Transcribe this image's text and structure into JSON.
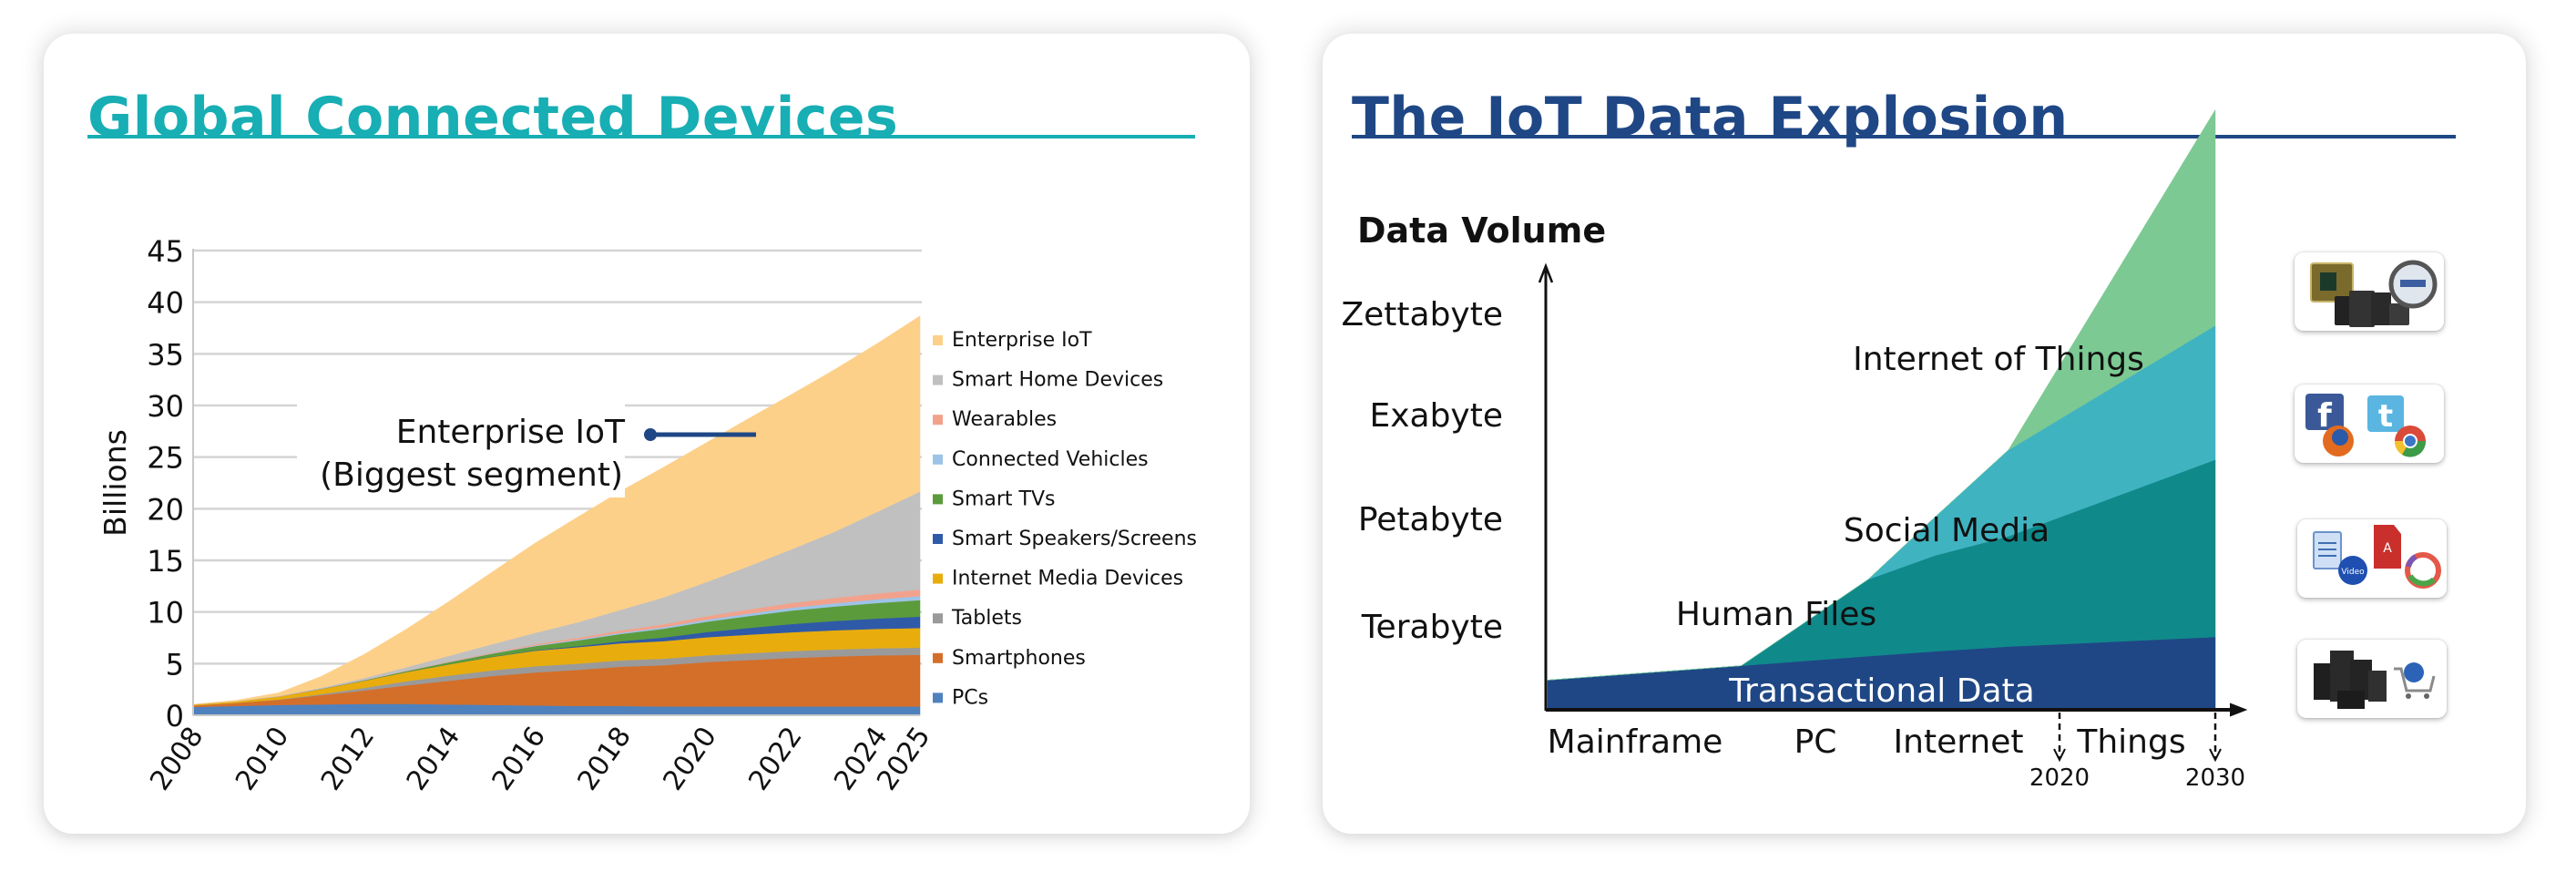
{
  "left_panel": {
    "title": "Global Connected Devices",
    "accent_color": "#17aeb4",
    "annotation": {
      "line1": "Enterprise IoT",
      "line2": "(Biggest segment)",
      "pointer_color": "#1f4785"
    }
  },
  "right_panel": {
    "title": "The IoT Data Explosion",
    "accent_color": "#1f4785",
    "icon_tiles": [
      {
        "name": "iot-devices-tile",
        "icons": [
          "chip-board-icon",
          "mobile-devices-icon",
          "smart-meter-icon"
        ]
      },
      {
        "name": "social-media-tile",
        "icons": [
          "facebook-icon",
          "twitter-icon",
          "firefox-icon",
          "chrome-icon"
        ]
      },
      {
        "name": "human-files-tile",
        "icons": [
          "document-icon",
          "video-icon",
          "pdf-icon",
          "picasa-icon"
        ]
      },
      {
        "name": "transactional-tile",
        "icons": [
          "server-rack-icon",
          "shopping-cart-icon"
        ]
      }
    ]
  },
  "chart_data": [
    {
      "type": "area",
      "stacked": true,
      "title": "Global Connected Devices",
      "xlabel": "",
      "ylabel": "Billions",
      "ylim": [
        0,
        45
      ],
      "yticks": [
        0,
        5,
        10,
        15,
        20,
        25,
        30,
        35,
        40,
        45
      ],
      "grid": true,
      "legend_position": "right",
      "x": [
        2008,
        2009,
        2010,
        2011,
        2012,
        2013,
        2014,
        2015,
        2016,
        2017,
        2018,
        2019,
        2020,
        2021,
        2022,
        2023,
        2024,
        2025
      ],
      "xtick_labels": [
        "2008",
        "2010",
        "2012",
        "2014",
        "2016",
        "2018",
        "2020",
        "2022",
        "2024",
        "2025"
      ],
      "series": [
        {
          "name": "PCs",
          "color": "#4f81bd",
          "values": [
            0.8,
            0.9,
            1.0,
            1.05,
            1.1,
            1.1,
            1.05,
            1.0,
            0.95,
            0.9,
            0.9,
            0.85,
            0.85,
            0.85,
            0.85,
            0.85,
            0.85,
            0.85
          ]
        },
        {
          "name": "Smartphones",
          "color": "#d46f2a",
          "values": [
            0.15,
            0.3,
            0.5,
            0.9,
            1.3,
            1.8,
            2.3,
            2.8,
            3.2,
            3.5,
            3.8,
            4.0,
            4.3,
            4.5,
            4.7,
            4.85,
            4.95,
            5.0
          ]
        },
        {
          "name": "Tablets",
          "color": "#9a9a9a",
          "values": [
            0.0,
            0.0,
            0.02,
            0.1,
            0.25,
            0.4,
            0.5,
            0.55,
            0.6,
            0.6,
            0.62,
            0.63,
            0.65,
            0.66,
            0.67,
            0.68,
            0.69,
            0.7
          ]
        },
        {
          "name": "Internet Media Devices",
          "color": "#e8ad0d",
          "values": [
            0.1,
            0.15,
            0.3,
            0.5,
            0.7,
            0.9,
            1.1,
            1.3,
            1.5,
            1.6,
            1.65,
            1.7,
            1.75,
            1.8,
            1.82,
            1.85,
            1.88,
            1.9
          ]
        },
        {
          "name": "Smart Speakers/Screens",
          "color": "#2f5aa8",
          "values": [
            0.0,
            0.0,
            0.0,
            0.0,
            0.0,
            0.0,
            0.0,
            0.02,
            0.05,
            0.1,
            0.2,
            0.35,
            0.5,
            0.65,
            0.8,
            0.9,
            1.0,
            1.1
          ]
        },
        {
          "name": "Smart TVs",
          "color": "#5b9b3c",
          "values": [
            0.0,
            0.0,
            0.0,
            0.02,
            0.05,
            0.1,
            0.2,
            0.3,
            0.4,
            0.55,
            0.7,
            0.85,
            1.0,
            1.15,
            1.3,
            1.4,
            1.5,
            1.6
          ]
        },
        {
          "name": "Connected Vehicles",
          "color": "#9dc3e6",
          "values": [
            0.0,
            0.0,
            0.0,
            0.0,
            0.0,
            0.0,
            0.02,
            0.04,
            0.06,
            0.09,
            0.12,
            0.15,
            0.2,
            0.24,
            0.28,
            0.32,
            0.36,
            0.4
          ]
        },
        {
          "name": "Wearables",
          "color": "#f2a28c",
          "values": [
            0.0,
            0.0,
            0.0,
            0.0,
            0.0,
            0.02,
            0.05,
            0.08,
            0.12,
            0.17,
            0.22,
            0.28,
            0.34,
            0.4,
            0.46,
            0.52,
            0.57,
            0.62
          ]
        },
        {
          "name": "Smart Home Devices",
          "color": "#c0c0c0",
          "values": [
            0.0,
            0.0,
            0.05,
            0.1,
            0.2,
            0.35,
            0.55,
            0.8,
            1.1,
            1.5,
            2.0,
            2.6,
            3.3,
            4.2,
            5.2,
            6.4,
            7.9,
            9.5
          ]
        },
        {
          "name": "Enterprise IoT",
          "color": "#fdd08a",
          "values": [
            0.0,
            0.1,
            0.3,
            1.1,
            2.3,
            3.7,
            5.3,
            7.0,
            8.7,
            10.2,
            11.5,
            12.6,
            13.5,
            14.3,
            15.0,
            15.7,
            16.3,
            17.0
          ]
        }
      ]
    },
    {
      "type": "area",
      "stacked": true,
      "title": "The IoT Data Explosion",
      "ylabel": "Data Volume",
      "yticks": [
        "Terabyte",
        "Petabyte",
        "Exabyte",
        "Zettabyte"
      ],
      "xticks": [
        "Mainframe",
        "PC",
        "Internet",
        "Things"
      ],
      "x_markers": [
        "2020",
        "2030"
      ],
      "x": [
        0,
        0.29,
        0.48,
        0.58,
        0.69,
        1.0
      ],
      "series": [
        {
          "name": "Transactional Data",
          "color": "#1f4785",
          "values": [
            0.06,
            0.09,
            0.11,
            0.12,
            0.13,
            0.15
          ]
        },
        {
          "name": "Human Files",
          "color": "#10898b",
          "values": [
            0.0,
            0.0,
            0.16,
            0.2,
            0.23,
            0.37
          ]
        },
        {
          "name": "Social Media",
          "color": "#40b3c1",
          "values": [
            0.0,
            0.0,
            0.0,
            0.08,
            0.18,
            0.28
          ]
        },
        {
          "name": "Internet of Things",
          "color": "#7cc993",
          "values": [
            0.0,
            0.0,
            0.0,
            0.0,
            0.0,
            0.45
          ]
        }
      ],
      "labels": {
        "transactional": "Transactional Data",
        "human_files": "Human Files",
        "social_media": "Social Media",
        "iot": "Internet of Things"
      }
    }
  ]
}
